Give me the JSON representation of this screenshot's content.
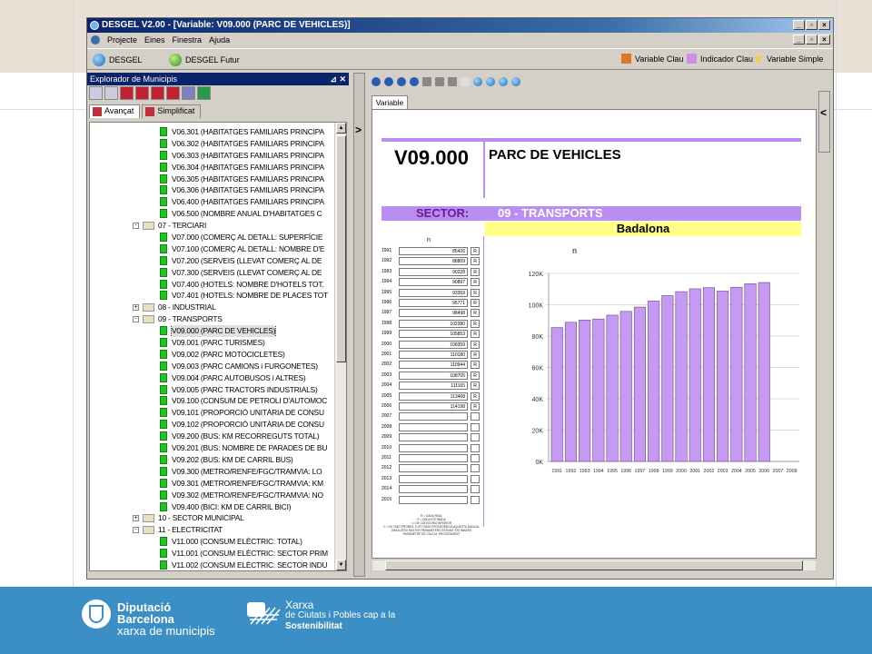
{
  "window": {
    "title": "DESGEL V2.00 - [Variable: V09.000 (PARC DE VEHICLES)]",
    "menu": [
      "Projecte",
      "Eines",
      "Finestra",
      "Ajuda"
    ]
  },
  "toolbar": {
    "desgel_label": "DESGEL",
    "futur_label": "DESGEL Futur",
    "legend": [
      {
        "label": "Variable Clau",
        "color": "#e07820"
      },
      {
        "label": "Indicador Clau",
        "color": "#c890e8"
      },
      {
        "label": "Variable Simple",
        "color": "#f0d030"
      }
    ]
  },
  "explorer": {
    "title": "Explorador de Municipis",
    "tabs": [
      "Avançat",
      "Simplificat"
    ],
    "items": [
      {
        "label": "V06.301 (HABITATGES FAMILIARS PRINCIPA",
        "type": "leaf"
      },
      {
        "label": "V06.302 (HABITATGES FAMILIARS PRINCIPA",
        "type": "leaf"
      },
      {
        "label": "V06.303 (HABITATGES FAMILIARS PRINCIPA",
        "type": "leaf"
      },
      {
        "label": "V06.304 (HABITATGES FAMILIARS PRINCIPA",
        "type": "leaf"
      },
      {
        "label": "V06.305 (HABITATGES FAMILIARS PRINCIPA",
        "type": "leaf"
      },
      {
        "label": "V06.306 (HABITATGES FAMILIARS PRINCIPA",
        "type": "leaf"
      },
      {
        "label": "V06.400 (HABITATGES FAMILIARS PRINCIPA",
        "type": "leaf"
      },
      {
        "label": "V06.500 (NOMBRE ANUAL D'HABITATGES C",
        "type": "leaf"
      },
      {
        "label": "07 - TERCIARI",
        "type": "folder",
        "exp": "-"
      },
      {
        "label": "V07.000 (COMERÇ AL DETALL: SUPERFÍCIE",
        "type": "leaf"
      },
      {
        "label": "V07.100 (COMERÇ AL DETALL: NOMBRE D'E",
        "type": "leaf"
      },
      {
        "label": "V07.200 (SERVEIS (LLEVAT COMERÇ AL DE",
        "type": "leaf"
      },
      {
        "label": "V07.300 (SERVEIS (LLEVAT COMERÇ AL DE",
        "type": "leaf"
      },
      {
        "label": "V07.400 (HOTELS: NOMBRE D'HOTELS TOT.",
        "type": "leaf"
      },
      {
        "label": "V07.401 (HOTELS: NOMBRE DE PLACES TOT",
        "type": "leaf"
      },
      {
        "label": "08 - INDUSTRIAL",
        "type": "folder",
        "exp": "+"
      },
      {
        "label": "09 - TRANSPORTS",
        "type": "folder",
        "exp": "-"
      },
      {
        "label": "V09.000 (PARC DE VEHICLES)",
        "type": "leaf",
        "selected": true
      },
      {
        "label": "V09.001 (PARC TURISMES)",
        "type": "leaf"
      },
      {
        "label": "V09.002 (PARC MOTOCICLETES)",
        "type": "leaf"
      },
      {
        "label": "V09.003 (PARC CAMIONS i FURGONETES)",
        "type": "leaf"
      },
      {
        "label": "V09.004 (PARC AUTOBUSOS i ALTRES)",
        "type": "leaf"
      },
      {
        "label": "V09.005 (PARC TRACTORS INDUSTRIALS)",
        "type": "leaf"
      },
      {
        "label": "V09.100 (CONSUM DE PETROLI D'AUTOMOC",
        "type": "leaf"
      },
      {
        "label": "V09.101 (PROPORCIÓ UNITÀRIA DE CONSU",
        "type": "leaf"
      },
      {
        "label": "V09.102 (PROPORCIÓ UNITÀRIA DE CONSU",
        "type": "leaf"
      },
      {
        "label": "V09.200 (BUS: KM RECORREGUTS TOTAL)",
        "type": "leaf"
      },
      {
        "label": "V09.201 (BUS: NOMBRE DE PARADES DE BU",
        "type": "leaf"
      },
      {
        "label": "V09.202 (BUS: KM DE CARRIL BUS)",
        "type": "leaf"
      },
      {
        "label": "V09.300 (METRO/RENFE/FGC/TRAMVIA: LO",
        "type": "leaf"
      },
      {
        "label": "V09.301 (METRO/RENFE/FGC/TRAMVIA: KM",
        "type": "leaf"
      },
      {
        "label": "V09.302 (METRO/RENFE/FGC/TRAMVIA: NO",
        "type": "leaf"
      },
      {
        "label": "V09.400 (BICI: KM DE CARRIL BICI)",
        "type": "leaf"
      },
      {
        "label": "10 - SECTOR MUNICIPAL",
        "type": "folder",
        "exp": "+"
      },
      {
        "label": "11 - ELECTRICITAT",
        "type": "folder",
        "exp": "-"
      },
      {
        "label": "V11.000 (CONSUM ELÈCTRIC: TOTAL)",
        "type": "leaf"
      },
      {
        "label": "V11.001 (CONSUM ELÈCTRIC: SECTOR PRIM",
        "type": "leaf"
      },
      {
        "label": "V11.002 (CONSUM ELÈCTRIC: SECTOR INDU",
        "type": "leaf"
      }
    ]
  },
  "document": {
    "tab": "Variable",
    "code": "V09.000",
    "name": "PARC DE VEHICLES",
    "sector_label": "SECTOR:",
    "sector_value": "09 - TRANSPORTS",
    "place": "Badalona",
    "unit": "n",
    "table": [
      {
        "year": "1991",
        "value": "85426",
        "mark": "R"
      },
      {
        "year": "1992",
        "value": "88809",
        "mark": "R"
      },
      {
        "year": "1993",
        "value": "90228",
        "mark": "R"
      },
      {
        "year": "1994",
        "value": "90897",
        "mark": "R"
      },
      {
        "year": "1995",
        "value": "93359",
        "mark": "R"
      },
      {
        "year": "1996",
        "value": "95771",
        "mark": "R"
      },
      {
        "year": "1997",
        "value": "98498",
        "mark": "R"
      },
      {
        "year": "1998",
        "value": "102380",
        "mark": "R"
      },
      {
        "year": "1999",
        "value": "105853",
        "mark": "R"
      },
      {
        "year": "2000",
        "value": "108359",
        "mark": "R"
      },
      {
        "year": "2001",
        "value": "110180",
        "mark": "R"
      },
      {
        "year": "2002",
        "value": "110944",
        "mark": "R"
      },
      {
        "year": "2003",
        "value": "108705",
        "mark": "R"
      },
      {
        "year": "2004",
        "value": "111165",
        "mark": "R"
      },
      {
        "year": "2005",
        "value": "113468",
        "mark": "R"
      },
      {
        "year": "2006",
        "value": "114198",
        "mark": "R"
      },
      {
        "year": "2007",
        "value": "",
        "mark": ""
      },
      {
        "year": "2008",
        "value": "",
        "mark": ""
      },
      {
        "year": "2009",
        "value": "",
        "mark": ""
      },
      {
        "year": "2010",
        "value": "",
        "mark": ""
      },
      {
        "year": "2011",
        "value": "",
        "mark": ""
      },
      {
        "year": "2012",
        "value": "",
        "mark": ""
      },
      {
        "year": "2013",
        "value": "",
        "mark": ""
      },
      {
        "year": "2014",
        "value": "",
        "mark": ""
      },
      {
        "year": "2015",
        "value": "",
        "mark": ""
      }
    ],
    "notes": [
      "R = DADA REAL",
      "E = DADA ESTIMADA",
      "I = DE CATEGORIA INFERIOR",
      "2 = NO TANT PROBES, E DIT PASS PROCEDÈNCIA AQUESTA DADA AL",
      "SIMULATED RASTER PARAMETERS ESTIMAT ESTIMADES",
      "PARÀMETRE DE CÀLCUL PROCEDIMENT"
    ]
  },
  "chart_data": {
    "type": "bar",
    "title": "n",
    "categories": [
      "1991",
      "1992",
      "1993",
      "1994",
      "1995",
      "1996",
      "1997",
      "1998",
      "1999",
      "2000",
      "2001",
      "2002",
      "2003",
      "2004",
      "2005",
      "2006",
      "2007",
      "2008"
    ],
    "values": [
      85426,
      88809,
      90228,
      90897,
      93359,
      95771,
      98498,
      102380,
      105853,
      108359,
      110180,
      110944,
      108705,
      111165,
      113468,
      114198,
      null,
      null
    ],
    "ylim": [
      0,
      120000
    ],
    "yticks": [
      "0K",
      "20K",
      "40K",
      "60K",
      "80K",
      "100K",
      "120K"
    ],
    "grid": true,
    "bar_color": "#c69af2"
  },
  "footer": {
    "org_line1": "Diputació",
    "org_line2": "Barcelona",
    "org_line3": "xarxa de municipis",
    "net_line1": "Xarxa",
    "net_line2": "de Ciutats i Pobles cap a la",
    "net_line3": "Sostenibilitat"
  }
}
